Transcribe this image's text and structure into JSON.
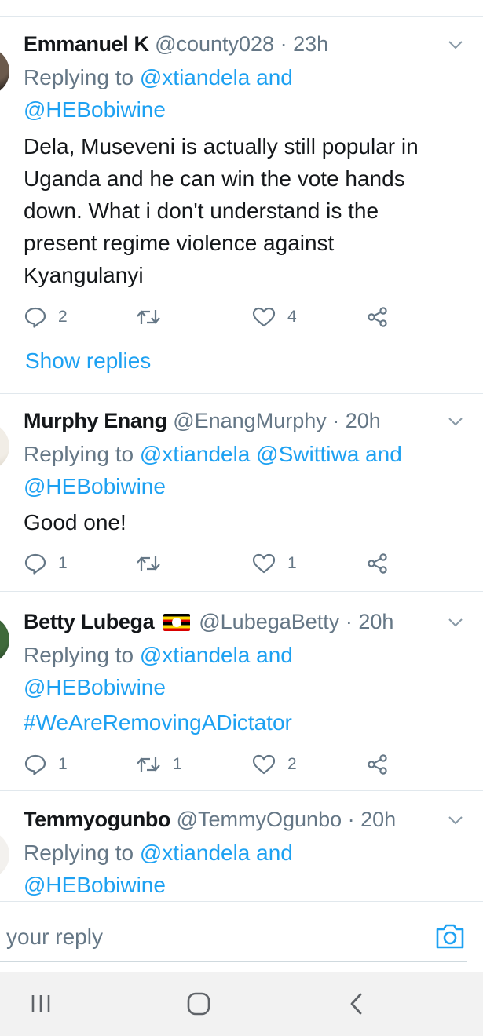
{
  "tweets": [
    {
      "name": "Emmanuel K",
      "handle": "@county028",
      "dot": "·",
      "time": "23h",
      "replying_prefix": "Replying to",
      "replying_1": "@xtiandela and",
      "replying_2": "@HEBobiwine",
      "text": "Dela, Museveni is actually still popular in Uganda and he can win the vote hands down. What i don't understand is the present regime violence against Kyangulanyi",
      "reply_count": "2",
      "retweet_count": "",
      "like_count": "4",
      "show_replies": "Show replies"
    },
    {
      "name": "Murphy Enang",
      "handle": "@EnangMurphy",
      "dot": "·",
      "time": "20h",
      "replying_prefix": "Replying to",
      "replying_1": "@xtiandela @Swittiwa and",
      "replying_2": "@HEBobiwine",
      "text": "Good one!",
      "reply_count": "1",
      "retweet_count": "",
      "like_count": "1"
    },
    {
      "name": "Betty Lubega",
      "handle": "@LubegaBetty",
      "dot": "·",
      "time": "20h",
      "replying_prefix": "Replying to",
      "replying_1": "@xtiandela and",
      "replying_2": "@HEBobiwine",
      "text": "#WeAreRemovingADictator",
      "reply_count": "1",
      "retweet_count": "1",
      "like_count": "2"
    },
    {
      "name": "Temmyogunbo",
      "handle": "@TemmyOgunbo",
      "dot": "·",
      "time": "20h",
      "replying_prefix": "Replying to",
      "replying_1": "@xtiandela and",
      "replying_2": "@HEBobiwine"
    }
  ],
  "composer": {
    "placeholder": "your reply",
    "camera_icon": "camera-icon"
  },
  "navbar": {
    "icons": [
      "recent-apps-icon",
      "home-icon",
      "back-icon"
    ]
  },
  "colors": {
    "accent": "#1da1f2",
    "text": "#14171a",
    "muted": "#657786",
    "divider": "#e1e8ed",
    "navbar": "#f2f2f2"
  }
}
